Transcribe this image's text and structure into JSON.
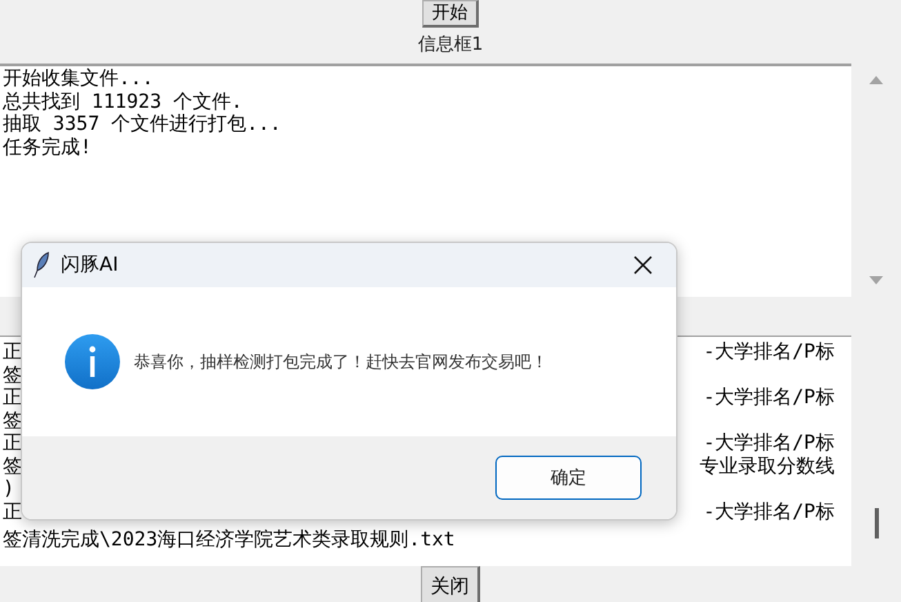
{
  "start_button": {
    "label": "开始"
  },
  "info_box_1": {
    "label": "信息框1",
    "lines": [
      "开始收集文件...",
      "总共找到 111923 个文件.",
      "抽取 3357 个文件进行打包...",
      "任务完成!"
    ]
  },
  "info_box_2": {
    "lines": [
      {
        "left": "正",
        "right": "-大学排名/P标"
      },
      {
        "left": "签"
      },
      {
        "left": "正",
        "right": "-大学排名/P标"
      },
      {
        "left": "签"
      },
      {
        "left": "正",
        "right": "-大学排名/P标"
      },
      {
        "left": "签",
        "right": "专业录取分数线"
      },
      {
        "left": ")"
      },
      {
        "left": "正",
        "right": "-大学排名/P标"
      },
      {
        "left": "签清洗完成\\2023海口经济学院艺术类录取规则.txt"
      }
    ]
  },
  "close_button": {
    "label": "关闭"
  },
  "dialog": {
    "title": "闪豚AI",
    "message": "恭喜你，抽样检测打包完成了！赶快去官网发布交易吧！",
    "ok_button": "确定"
  }
}
